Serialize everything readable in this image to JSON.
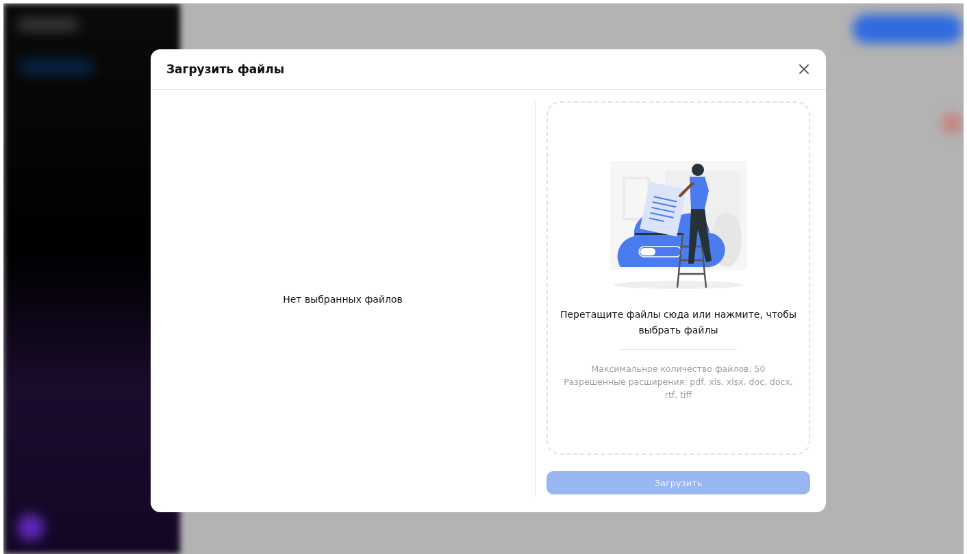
{
  "dialog": {
    "title": "Загрузить файлы",
    "file_list": {
      "empty_text": "Нет выбранных файлов"
    },
    "dropzone": {
      "prompt": "Перетащите файлы сюда или нажмите, чтобы выбрать файлы",
      "limits": [
        "Максимальное количество файлов: 50",
        "Разрешенные расширения: pdf, xls, xlsx, doc, docx, rtf, tiff"
      ]
    },
    "upload_button": {
      "label": "Загрузить",
      "disabled": true
    }
  }
}
